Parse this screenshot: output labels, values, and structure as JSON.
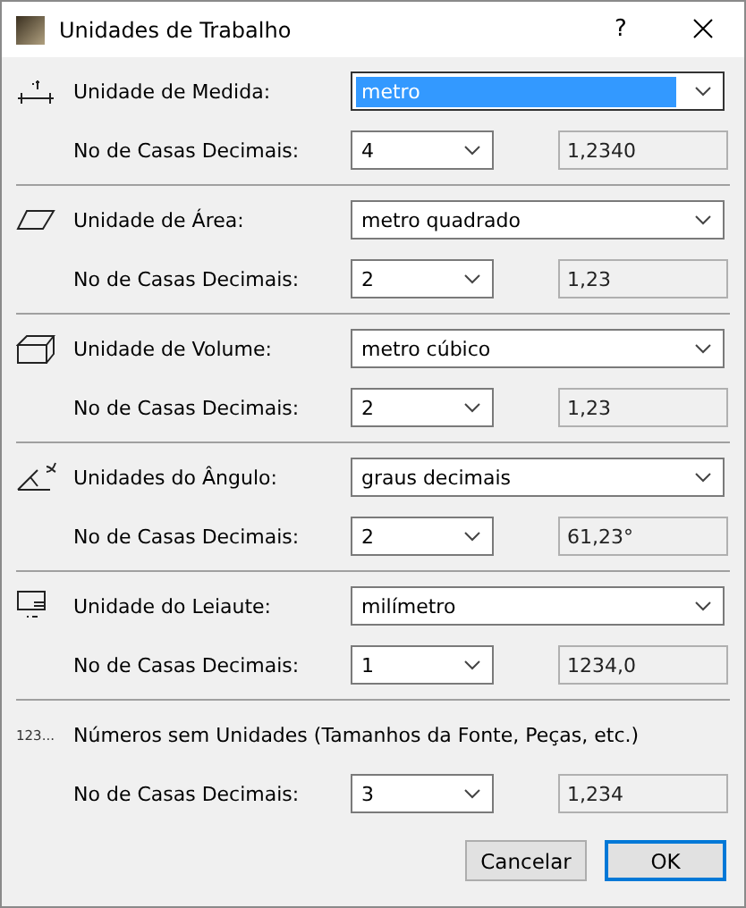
{
  "window": {
    "title": "Unidades de Trabalho",
    "help": "?"
  },
  "sections": [
    {
      "kind": "measure",
      "label": "Unidade de Medida:",
      "unit": "metro",
      "focused": true,
      "decimals_label": "No de Casas Decimais:",
      "decimals": "4",
      "preview": "1,2340"
    },
    {
      "kind": "area",
      "label": "Unidade de Área:",
      "unit": "metro quadrado",
      "focused": false,
      "decimals_label": "No de Casas Decimais:",
      "decimals": "2",
      "preview": "1,23"
    },
    {
      "kind": "volume",
      "label": "Unidade de Volume:",
      "unit": "metro cúbico",
      "focused": false,
      "decimals_label": "No de Casas Decimais:",
      "decimals": "2",
      "preview": "1,23"
    },
    {
      "kind": "angle",
      "label": "Unidades do Ângulo:",
      "unit": "graus decimais",
      "focused": false,
      "decimals_label": "No de Casas Decimais:",
      "decimals": "2",
      "preview": "61,23°"
    },
    {
      "kind": "layout",
      "label": "Unidade do Leiaute:",
      "unit": "milímetro",
      "focused": false,
      "decimals_label": "No de Casas Decimais:",
      "decimals": "1",
      "preview": "1234,0"
    },
    {
      "kind": "numbers",
      "icon_text": "123...",
      "label": "Números sem Unidades (Tamanhos da Fonte, Peças, etc.)",
      "decimals_label": "No de Casas Decimais:",
      "decimals": "3",
      "preview": "1,234"
    }
  ],
  "buttons": [
    {
      "label": "Cancelar",
      "default": false
    },
    {
      "label": "OK",
      "default": true
    }
  ]
}
